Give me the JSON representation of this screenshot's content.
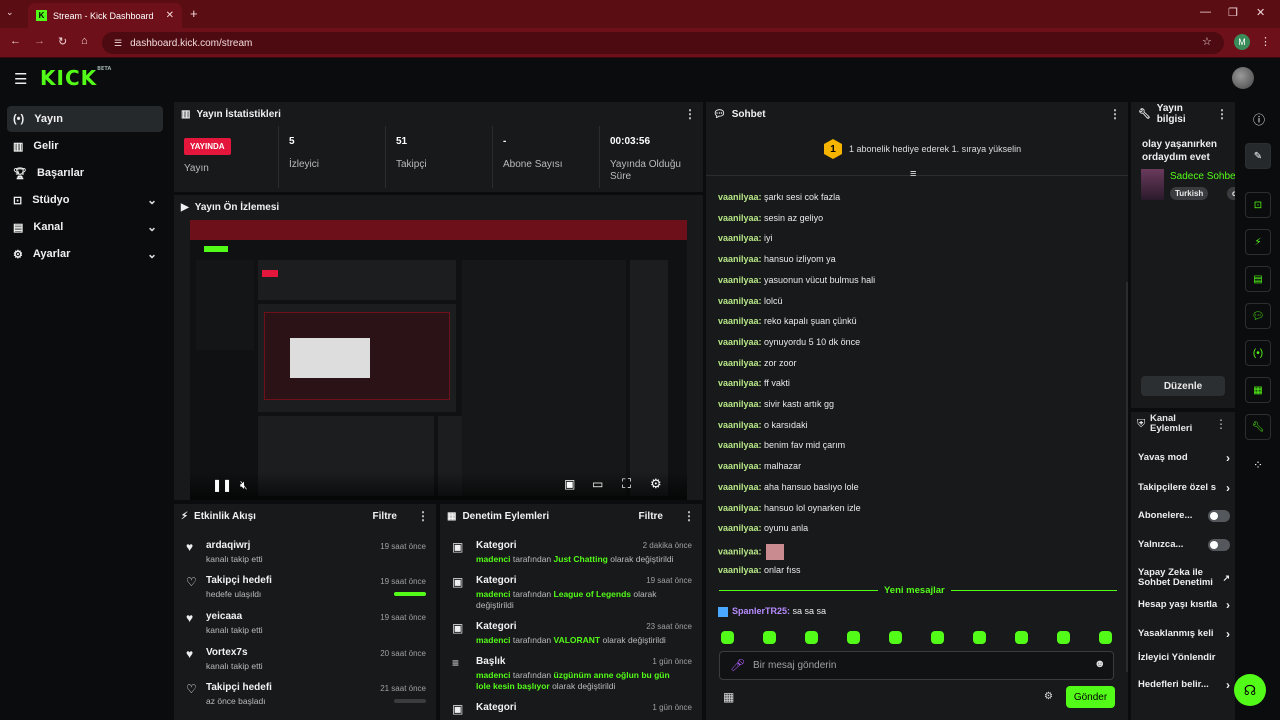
{
  "browser": {
    "tab_title": "Stream - Kick Dashboard",
    "url": "dashboard.kick.com/stream",
    "profile_initial": "M"
  },
  "app": {
    "logo": "KICK",
    "logo_tag": "BETA"
  },
  "sidebar": {
    "items": [
      {
        "label": "Yayın",
        "icon": "broadcast-icon"
      },
      {
        "label": "Gelir",
        "icon": "chart-icon"
      },
      {
        "label": "Başarılar",
        "icon": "trophy-icon"
      },
      {
        "label": "Stüdyo",
        "icon": "studio-icon"
      },
      {
        "label": "Kanal",
        "icon": "channel-icon"
      },
      {
        "label": "Ayarlar",
        "icon": "gear-icon"
      }
    ]
  },
  "stats": {
    "title": "Yayın İstatistikleri",
    "live_badge": "YAYINDA",
    "live_label": "Yayın",
    "items": [
      {
        "value": "5",
        "label": "İzleyici"
      },
      {
        "value": "51",
        "label": "Takipçi"
      },
      {
        "value": "-",
        "label": "Abone Sayısı"
      },
      {
        "value": "00:03:56",
        "label": "Yayında Olduğu Süre"
      }
    ]
  },
  "preview": {
    "title": "Yayın Ön İzlemesi"
  },
  "activity": {
    "title": "Etkinlik Akışı",
    "filter": "Filtre",
    "items": [
      {
        "title": "ardaqiwrj",
        "sub": "kanalı takip etti",
        "time": "19 saat önce"
      },
      {
        "title": "Takipçi hedefi",
        "sub": "hedefe ulaşıldı",
        "time": "19 saat önce",
        "progress": 1.0
      },
      {
        "title": "yeicaaa",
        "sub": "kanalı takip etti",
        "time": "19 saat önce"
      },
      {
        "title": "Vortex7s",
        "sub": "kanalı takip etti",
        "time": "20 saat önce"
      },
      {
        "title": "Takipçi hedefi",
        "sub": "az önce başladı",
        "time": "21 saat önce",
        "progress": 0.0
      }
    ]
  },
  "moderation": {
    "title": "Denetim Eylemleri",
    "filter": "Filtre",
    "items": [
      {
        "title": "Kategori",
        "user": "madenci",
        "mid": "tarafından",
        "value": "Just Chatting",
        "end": "olarak değiştirildi",
        "time": "2 dakika önce"
      },
      {
        "title": "Kategori",
        "user": "madenci",
        "mid": "tarafından",
        "value": "League of Legends",
        "end": "olarak değiştirildi",
        "time": "19 saat önce"
      },
      {
        "title": "Kategori",
        "user": "madenci",
        "mid": "tarafından",
        "value": "VALORANT",
        "end": "olarak değiştirildi",
        "time": "23 saat önce"
      },
      {
        "title": "Başlık",
        "user": "madenci",
        "mid": "tarafından",
        "value": "üzgünüm anne oğlun bu gün lole kesin başlıyor",
        "end": "olarak değiştirildi",
        "time": "1 gün önce"
      },
      {
        "title": "Kategori",
        "time": "1 gün önce"
      }
    ]
  },
  "chat": {
    "title": "Sohbet",
    "rank_number": "1",
    "rank_text": "1 abonelik hediye ederek 1. sıraya yükselin",
    "messages": [
      {
        "user": "vaanilyaa:",
        "text": "şarkı sesi cok fazla"
      },
      {
        "user": "vaanilyaa:",
        "text": "sesin az geliyo"
      },
      {
        "user": "vaanilyaa:",
        "text": "iyi"
      },
      {
        "user": "vaanilyaa:",
        "text": "hansuo izliyom ya"
      },
      {
        "user": "vaanilyaa:",
        "text": "yasuonun vücut bulmus hali"
      },
      {
        "user": "vaanilyaa:",
        "text": "lolcü"
      },
      {
        "user": "vaanilyaa:",
        "text": "reko kapalı şuan çünkü"
      },
      {
        "user": "vaanilyaa:",
        "text": "oynuyordu 5 10 dk önce"
      },
      {
        "user": "vaanilyaa:",
        "text": "zor zoor"
      },
      {
        "user": "vaanilyaa:",
        "text": "ff vakti"
      },
      {
        "user": "vaanilyaa:",
        "text": "sivir kastı artık gg"
      },
      {
        "user": "vaanilyaa:",
        "text": "o karsıdaki"
      },
      {
        "user": "vaanilyaa:",
        "text": "benim fav mid çarım"
      },
      {
        "user": "vaanilyaa:",
        "text": "malhazar"
      },
      {
        "user": "vaanilyaa:",
        "text": "aha hansuo baslıyo lole"
      },
      {
        "user": "vaanilyaa:",
        "text": "hansuo lol oynarken izle"
      },
      {
        "user": "vaanilyaa:",
        "text": "oyunu anla"
      },
      {
        "user": "vaanilyaa:",
        "text": ""
      },
      {
        "user": "vaanilyaa:",
        "text": "onlar fıss"
      }
    ],
    "new_messages": "Yeni mesajlar",
    "new_user": "SpanlerTR25:",
    "new_text": "sa sa sa",
    "input_placeholder": "Bir mesaj gönderin",
    "send": "Gönder"
  },
  "info": {
    "title": "Yayın bilgisi",
    "stream_title": "olay yaşanırken ordaydım evet",
    "category": "Sadece Sohbet",
    "tag1": "Turkish",
    "tag2": "c",
    "edit": "Düzenle"
  },
  "channel_actions": {
    "title": "Kanal Eylemleri",
    "items": [
      {
        "label": "Yavaş mod",
        "kind": "chev"
      },
      {
        "label": "Takipçilere özel s",
        "kind": "chev"
      },
      {
        "label": "Abonelere...",
        "kind": "toggle"
      },
      {
        "label": "Yalnızca...",
        "kind": "toggle"
      },
      {
        "label": "Yapay Zeka ile Sohbet Denetimi",
        "kind": "ext"
      },
      {
        "label": "Hesap yaşı kısıtla",
        "kind": "chev"
      },
      {
        "label": "Yasaklanmış keli",
        "kind": "chev"
      },
      {
        "label": "İzleyici Yönlendir",
        "kind": "none"
      },
      {
        "label": "Hedefleri belir...",
        "kind": "chev"
      }
    ]
  },
  "colors": {
    "accent": "#53fc18",
    "live": "#e4163c",
    "panel": "#18191b",
    "chrome": "#6e1019"
  }
}
